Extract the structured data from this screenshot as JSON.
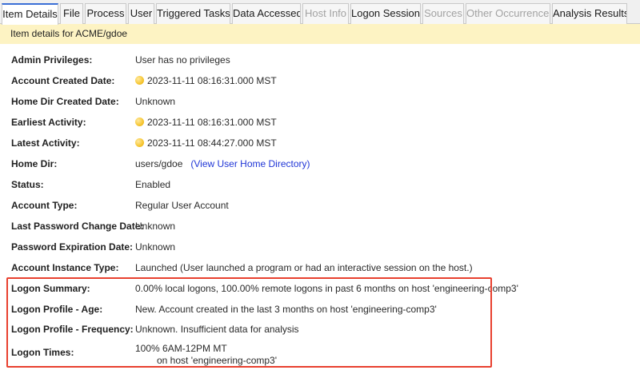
{
  "tabs": [
    {
      "label": "Item Details",
      "state": "active"
    },
    {
      "label": "File",
      "state": "normal"
    },
    {
      "label": "Process",
      "state": "normal"
    },
    {
      "label": "User",
      "state": "normal"
    },
    {
      "label": "Triggered Tasks",
      "state": "normal"
    },
    {
      "label": "Data Accessed",
      "state": "normal"
    },
    {
      "label": "Host Info",
      "state": "disabled"
    },
    {
      "label": "Logon Session",
      "state": "normal"
    },
    {
      "label": "Sources",
      "state": "disabled"
    },
    {
      "label": "Other Occurrences",
      "state": "disabled"
    },
    {
      "label": "Analysis Results",
      "state": "normal"
    }
  ],
  "info_bar": {
    "text": "Item details for ACME/gdoe"
  },
  "details": [
    {
      "label": "Admin Privileges:",
      "value": "User has no privileges"
    },
    {
      "label": "Account Created Date:",
      "value": "2023-11-11 08:16:31.000 MST",
      "icon": "yellow-dot-icon"
    },
    {
      "label": "Home Dir Created Date:",
      "value": "Unknown"
    },
    {
      "label": "Earliest Activity:",
      "value": "2023-11-11 08:16:31.000 MST",
      "icon": "yellow-dot-icon"
    },
    {
      "label": "Latest Activity:",
      "value": "2023-11-11 08:44:27.000 MST",
      "icon": "yellow-dot-icon"
    },
    {
      "label": "Home Dir:",
      "value": "users/gdoe",
      "link": "(View User Home Directory)"
    },
    {
      "label": "Status:",
      "value": "Enabled"
    },
    {
      "label": "Account Type:",
      "value": "Regular User Account"
    },
    {
      "label": "Last Password Change Date:",
      "value": "Unknown"
    },
    {
      "label": "Password Expiration Date:",
      "value": "Unknown"
    },
    {
      "label": "Account Instance Type:",
      "value": "Launched (User launched a program or had an interactive session on the host.)"
    },
    {
      "label": "Logon Summary:",
      "value": "0.00% local logons, 100.00% remote logons in past 6 months on host 'engineering-comp3'"
    },
    {
      "label": "Logon Profile - Age:",
      "value": "New. Account created in the last 3 months on host 'engineering-comp3'"
    },
    {
      "label": "Logon Profile - Frequency:",
      "value": "Unknown. Insufficient data for analysis"
    },
    {
      "label": "Logon Times:",
      "value": "100% 6AM-12PM MT",
      "value_line2": "on host 'engineering-comp3'"
    }
  ],
  "colors": {
    "tab_active_accent": "#3b6fd6",
    "info_bar_bg": "#fdf3c3",
    "link": "#1f35d6",
    "highlight_border": "#e8402f",
    "status_dot": "#f7c93a"
  }
}
